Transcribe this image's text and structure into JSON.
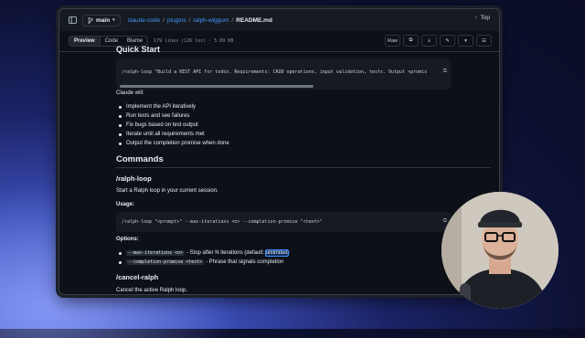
{
  "topbar": {
    "branch": "main",
    "crumbs": [
      "claude-code",
      "plugins",
      "ralph-wiggum"
    ],
    "file": "README.md",
    "top_label": "Top"
  },
  "filebar": {
    "tabs": [
      "Preview",
      "Code",
      "Blame"
    ],
    "meta": "179 lines (126 loc) · 5.09 KB",
    "raw": "Raw"
  },
  "doc": {
    "section_title": "Quick Start",
    "quick_cmd": "/ralph-loop \"Build a REST API for todos. Requirements: CRUD operations, input validation, tests. Output <promise>COM",
    "claude_will": "Claude will:",
    "steps": [
      "Implement the API iteratively",
      "Run tests and see failures",
      "Fix bugs based on test output",
      "Iterate until all requirements met",
      "Output the completion promise when done"
    ],
    "commands_title": "Commands",
    "loop_title": "/ralph-loop",
    "loop_desc": "Start a Ralph loop in your current session.",
    "usage_label": "Usage:",
    "usage_cmd": "/ralph-loop \"<prompt>\" --max-iterations <n> --completion-promise \"<text>\"",
    "options_label": "Options:",
    "opt1_code": "--max-iterations <n>",
    "opt1_text": " - Stop after N iterations (default: ",
    "opt1_hl": "unlimited",
    "opt1_end": ")",
    "opt2_code": "--completion-promise <text>",
    "opt2_text": " - Phrase that signals completion",
    "cancel_title": "/cancel-ralph",
    "cancel_desc": "Cancel the active Ralph loop."
  },
  "colors": {
    "accent": "#4493f8",
    "bg": "#0d1117",
    "text": "#e6edf3"
  }
}
